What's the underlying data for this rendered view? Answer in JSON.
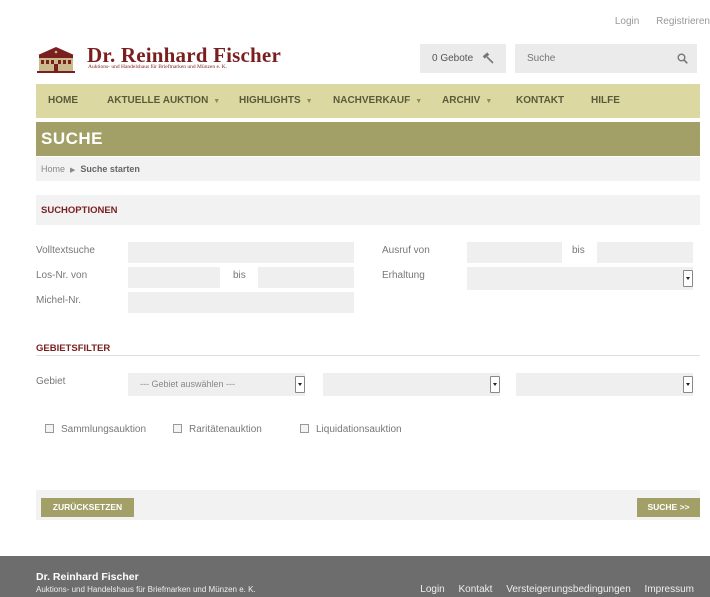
{
  "top_links": {
    "login": "Login",
    "register": "Registrieren"
  },
  "header": {
    "logo_title": "Dr. Reinhard Fischer",
    "logo_subtitle": "Auktions- und Handelshaus für Briefmarken und Münzen e. K.",
    "bids_label": "0 Gebote",
    "search_placeholder": "Suche"
  },
  "nav": {
    "items": [
      {
        "label": "HOME"
      },
      {
        "label": "AKTUELLE AUKTION"
      },
      {
        "label": "HIGHLIGHTS"
      },
      {
        "label": "NACHVERKAUF"
      },
      {
        "label": "ARCHIV"
      },
      {
        "label": "KONTAKT"
      },
      {
        "label": "HILFE"
      }
    ]
  },
  "page": {
    "title": "SUCHE",
    "breadcrumb": {
      "home": "Home",
      "current": "Suche starten"
    }
  },
  "search_options": {
    "heading": "SUCHOPTIONEN",
    "fulltext_label": "Volltextsuche",
    "lot_from_label": "Los-Nr. von",
    "lot_to_label": "bis",
    "michel_label": "Michel-Nr.",
    "price_from_label": "Ausruf von",
    "price_to_label": "bis",
    "condition_label": "Erhaltung",
    "fulltext_value": "",
    "lot_from_value": "",
    "lot_to_value": "",
    "michel_value": "",
    "price_from_value": "",
    "price_to_value": "",
    "condition_value": ""
  },
  "area_filter": {
    "heading": "GEBIETSFILTER",
    "area_label": "Gebiet",
    "area_select_value": "--- Gebiet auswählen ---",
    "sub_select_1_value": "",
    "sub_select_2_value": ""
  },
  "checkboxes": [
    {
      "label": "Sammlungsauktion",
      "checked": false
    },
    {
      "label": "Raritätenauktion",
      "checked": false
    },
    {
      "label": "Liquidationsauktion",
      "checked": false
    }
  ],
  "buttons": {
    "reset": "ZURÜCKSETZEN",
    "search": "SUCHE >>"
  },
  "footer": {
    "name": "Dr. Reinhard Fischer",
    "subtitle": "Auktions- und Handelshaus für Briefmarken und Münzen e. K.",
    "links": [
      "Login",
      "Kontakt",
      "Versteigerungsbedingungen",
      "Impressum"
    ]
  },
  "colors": {
    "brand_red": "#7a1f1f",
    "nav_bg": "#dbd9a1",
    "accent_olive": "#a2a067",
    "footer_bg": "#6d6d6d"
  }
}
